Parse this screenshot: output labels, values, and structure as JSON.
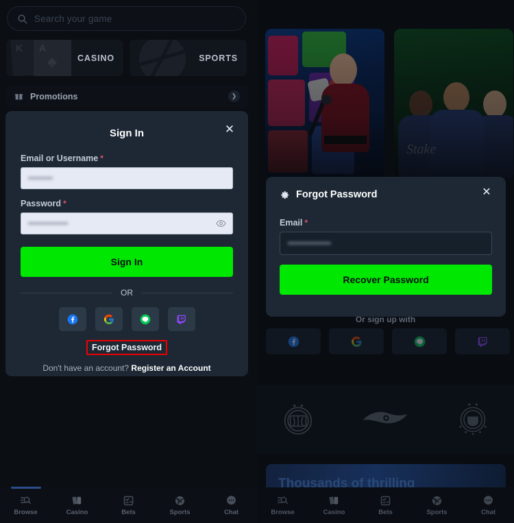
{
  "colors": {
    "accent_green": "#00e701",
    "modal_bg": "#1d2834",
    "page_bg": "#0b0e13",
    "highlight_red": "#ee0000",
    "required_red": "#e0536b",
    "active_indicator_blue": "#2c4d8c"
  },
  "left": {
    "search": {
      "placeholder": "Search your game",
      "icon": "search-icon"
    },
    "tiles": [
      {
        "label": "CASINO",
        "art": "playing-cards-icon"
      },
      {
        "label": "SPORTS",
        "art": "basketball-icon"
      }
    ],
    "promotions": {
      "label": "Promotions",
      "icon": "gift-icon",
      "chevron": "chevron-right-icon"
    },
    "signin_modal": {
      "title": "Sign In",
      "close_label": "✕",
      "fields": [
        {
          "label": "Email or Username",
          "required_marker": "*",
          "value": "••••••••",
          "type": "text"
        },
        {
          "label": "Password",
          "required_marker": "*",
          "value": "•••••••••••••",
          "type": "password",
          "toggle_icon": "eye-icon"
        }
      ],
      "submit_label": "Sign In",
      "divider_label": "OR",
      "social": [
        {
          "name": "facebook",
          "label": "Facebook"
        },
        {
          "name": "google",
          "label": "Google"
        },
        {
          "name": "line",
          "label": "LINE"
        },
        {
          "name": "twitch",
          "label": "Twitch"
        }
      ],
      "forgot_label": "Forgot Password",
      "register_prefix": "Don't have an account?",
      "register_label": "Register an Account"
    }
  },
  "right": {
    "banners": [
      {
        "name": "casino-live-banner",
        "watermark": ""
      },
      {
        "name": "sports-everton-banner",
        "watermark": "Stake"
      }
    ],
    "forgot_modal": {
      "title": "Forgot Password",
      "icon": "gear-icon",
      "close_label": "✕",
      "field": {
        "label": "Email",
        "required_marker": "*",
        "value": "••••••••••••••"
      },
      "submit_label": "Recover Password"
    },
    "or_signup_label": "Or sign up with",
    "social": [
      {
        "name": "facebook",
        "label": "Facebook"
      },
      {
        "name": "google",
        "label": "Google"
      },
      {
        "name": "line",
        "label": "LINE"
      },
      {
        "name": "twitch",
        "label": "Twitch"
      }
    ],
    "sponsors": [
      {
        "name": "everton-fc-logo"
      },
      {
        "name": "team-secret-logo"
      },
      {
        "name": "ufc-logo"
      }
    ],
    "promo_card": {
      "title": "Thousands of thrilling"
    }
  },
  "bottom_nav": {
    "active": "Browse",
    "items": [
      {
        "label": "Browse",
        "icon": "browse-icon"
      },
      {
        "label": "Casino",
        "icon": "cards-icon"
      },
      {
        "label": "Bets",
        "icon": "bet-slip-icon"
      },
      {
        "label": "Sports",
        "icon": "sports-ball-icon"
      },
      {
        "label": "Chat",
        "icon": "chat-icon"
      }
    ]
  }
}
